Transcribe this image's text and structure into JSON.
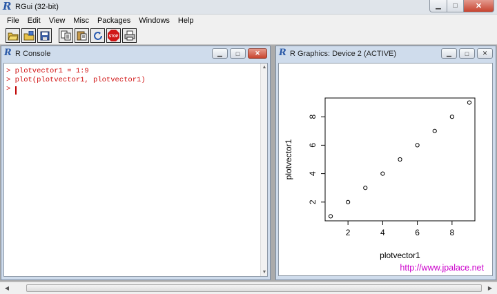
{
  "app": {
    "title": "RGui (32-bit)"
  },
  "menu": [
    "File",
    "Edit",
    "View",
    "Misc",
    "Packages",
    "Windows",
    "Help"
  ],
  "toolbar": {
    "buttons": [
      "open-script-icon",
      "load-workspace-icon",
      "save-icon",
      "copy-icon",
      "paste-icon",
      "refresh-icon",
      "stop-icon",
      "print-icon"
    ],
    "stop_label": "STOP"
  },
  "console": {
    "title": "R Console",
    "lines": [
      "> plotvector1 = 1:9",
      "> plot(plotvector1, plotvector1)",
      ">"
    ]
  },
  "graphics": {
    "title": "R Graphics: Device 2 (ACTIVE)",
    "watermark": "http://www.jpalace.net"
  },
  "colors": {
    "console_text": "#d01010",
    "r_logo": "#2b5aa8",
    "watermark": "#cc00cc"
  },
  "chart_data": {
    "type": "scatter",
    "x": [
      1,
      2,
      3,
      4,
      5,
      6,
      7,
      8,
      9
    ],
    "y": [
      1,
      2,
      3,
      4,
      5,
      6,
      7,
      8,
      9
    ],
    "xlabel": "plotvector1",
    "ylabel": "plotvector1",
    "xticks": [
      "2",
      "4",
      "6",
      "8"
    ],
    "yticks": [
      "2",
      "4",
      "6",
      "8"
    ],
    "xlim": [
      0.68,
      9.32
    ],
    "ylim": [
      0.68,
      9.32
    ],
    "grid": false,
    "marker": "open-circle"
  }
}
